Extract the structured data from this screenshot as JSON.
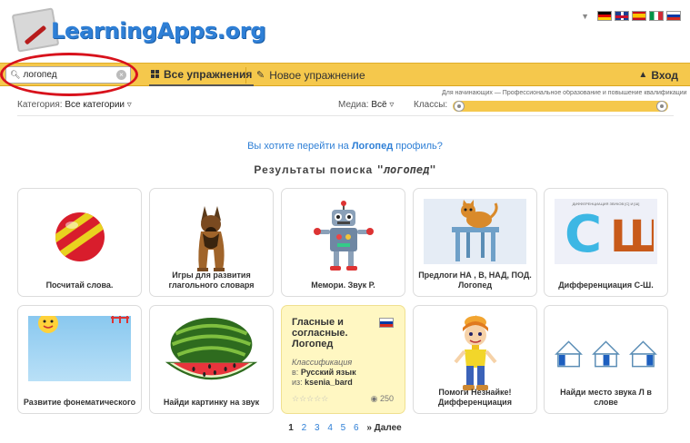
{
  "logo": {
    "text": "LearningApps.org"
  },
  "languages": [
    "de",
    "en",
    "es",
    "it",
    "ru"
  ],
  "search": {
    "value": "логопед",
    "placeholder": ""
  },
  "nav": {
    "all_exercises": "Все упражнения",
    "new_exercise": "Новое упражнение",
    "login": "Вход"
  },
  "filters": {
    "category_label": "Категория:",
    "category_value": "Все категории",
    "media_label": "Медиа:",
    "media_value": "Всё",
    "classes_label": "Классы:",
    "levels_caption": "Для начинающих — Профессиональное образование и повышение квалификации"
  },
  "profile_prompt": {
    "before": "Вы хотите перейти на ",
    "name": "Логопед",
    "after": " профиль?"
  },
  "results": {
    "title": "Результаты поиска",
    "query": "\"логопед\""
  },
  "cards": [
    {
      "title": "Посчитай слова.",
      "thumb": "striped-ball"
    },
    {
      "title": "Игры для развития глагольного словаря",
      "thumb": "dog"
    },
    {
      "title": "Мемори. Звук Р.",
      "thumb": "robot"
    },
    {
      "title": "Предлоги НА , В, НАД, ПОД. Логопед",
      "thumb": "cat-on-stool"
    },
    {
      "title": "Дифференциация С-Ш.",
      "thumb": "letters-s-sh",
      "thumb_caption": "ДИФФЕРЕНЦИАЦИЯ ЗВУКОВ [С] И [Ш]"
    },
    {
      "title": "Развитие фонематического",
      "thumb": "sun-sky"
    },
    {
      "title": "Найди картинку на звук",
      "thumb": "watermelon"
    },
    {
      "title": "Гласные и согласные. Логопед",
      "type": "Классификация",
      "subject_label": "в:",
      "subject": "Русский язык",
      "author_label": "из:",
      "author": "ksenia_bard",
      "views": "250",
      "rating_stars": "☆☆☆☆☆",
      "featured": true
    },
    {
      "title": "Помоги Незнайке! Дифференциация",
      "thumb": "neznaika"
    },
    {
      "title": "Найди место звука Л в слове",
      "thumb": "houses"
    }
  ],
  "pagination": {
    "pages": [
      "1",
      "2",
      "3",
      "4",
      "5",
      "6"
    ],
    "current": "1",
    "next": "» Далее"
  },
  "colors": {
    "toolbar": "#f5c84c",
    "link": "#2e7fd6",
    "highlight_ellipse": "#d8121c"
  }
}
